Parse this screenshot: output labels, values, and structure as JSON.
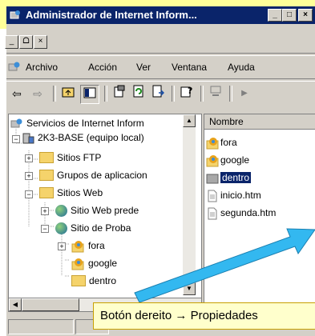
{
  "window": {
    "title": "Administrador de Internet Inform...",
    "minimize": "_",
    "maximize": "□",
    "close": "×"
  },
  "mdi_controls": [
    "_",
    "ᗝ",
    "×"
  ],
  "menu": [
    "Archivo",
    "Acción",
    "Ver",
    "Ventana",
    "Ayuda"
  ],
  "tree": [
    {
      "label": "Servicios de Internet Inform",
      "icon": "computer-icon"
    },
    {
      "label": "2K3-BASE (equipo local)",
      "icon": "server-icon",
      "expander": "−"
    },
    {
      "label": "Sitios FTP",
      "icon": "folder-icon",
      "expander": "+"
    },
    {
      "label": "Grupos de aplicacion",
      "icon": "folder-icon",
      "expander": "+"
    },
    {
      "label": "Sitios Web",
      "icon": "folder-icon",
      "expander": "−"
    },
    {
      "label": "Sitio Web prede",
      "icon": "globe-icon",
      "expander": "+"
    },
    {
      "label": "Sitio de Proba",
      "icon": "globe-icon",
      "expander": "−"
    },
    {
      "label": "fora",
      "icon": "web-folder-icon",
      "expander": "+"
    },
    {
      "label": "google",
      "icon": "web-folder-icon"
    },
    {
      "label": "dentro",
      "icon": "folder-icon"
    }
  ],
  "list": {
    "column": "Nombre",
    "items": [
      {
        "label": "fora",
        "icon": "web-folder-icon",
        "selected": false
      },
      {
        "label": "google",
        "icon": "web-folder-icon",
        "selected": false
      },
      {
        "label": "dentro",
        "icon": "folder-icon",
        "selected": true
      },
      {
        "label": "inicio.htm",
        "icon": "document-icon",
        "selected": false
      },
      {
        "label": "segunda.htm",
        "icon": "document-icon",
        "selected": false
      }
    ]
  },
  "callout": {
    "text": "Botón dereito → Propiedades"
  },
  "colors": {
    "titlebar": "#0a246a",
    "selection": "#0a246a",
    "highlight_bg": "#ffff99",
    "arrow": "#33b8f0"
  }
}
